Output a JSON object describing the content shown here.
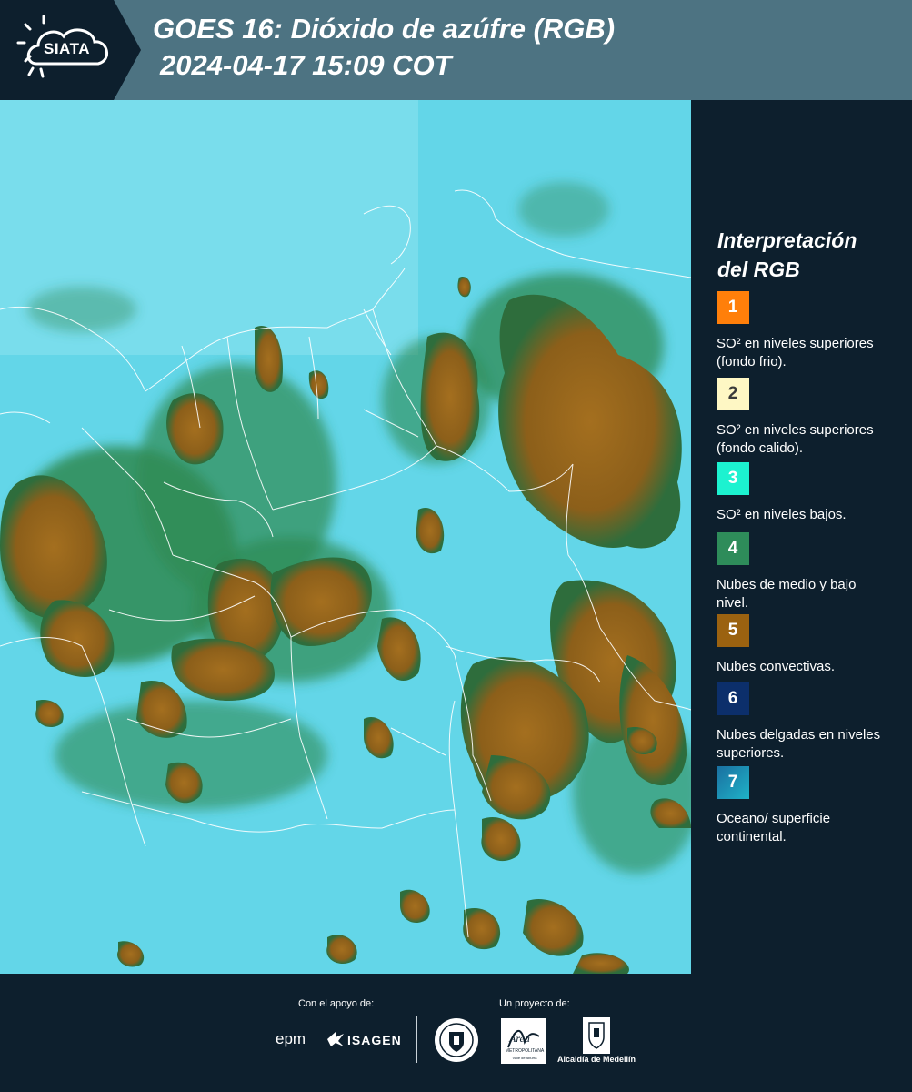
{
  "header": {
    "logo_text": "SIATA",
    "title_line1": "GOES 16: Dióxido de azúfre (RGB)",
    "title_line2": "2024-04-17 15:09 COT"
  },
  "legend": {
    "title_line1": "Interpretación",
    "title_line2": "del RGB",
    "items": [
      {
        "number": "1",
        "color": "#ff7f0a",
        "description": "SO² en niveles superiores (fondo frio)."
      },
      {
        "number": "2",
        "color": "#fef7c4",
        "description": "SO² en niveles superiores (fondo calido)."
      },
      {
        "number": "3",
        "color": "#1cf2d0",
        "description": "SO² en niveles bajos."
      },
      {
        "number": "4",
        "color": "#2e8c5a",
        "description": "Nubes de medio y bajo nivel."
      },
      {
        "number": "5",
        "color": "#9b6210",
        "description": "Nubes convectivas."
      },
      {
        "number": "6",
        "color": "#0c2f6b",
        "description": "Nubes delgadas en niveles superiores."
      },
      {
        "number": "7",
        "color": "#1a8fb2",
        "description": "Oceano/ superficie continental."
      }
    ]
  },
  "footer": {
    "support_label": "Con el apoyo de:",
    "project_label": "Un proyecto de:",
    "sponsors": [
      "epm",
      "ISAGEN"
    ],
    "partner_metro": "METROPOLITANA",
    "partner_metro_sub": "Valle de Aburrá",
    "partner_metro_word": "Área",
    "partner_alcaldia": "Alcaldía de Medellín"
  },
  "colors": {
    "header_bg": "#4d7382",
    "panel_bg": "#0d1f2d",
    "ocean_cyan": "#5fd9ea",
    "convective_brown": "#9b6a1e",
    "mid_cloud_green": "#2e8c5a"
  }
}
